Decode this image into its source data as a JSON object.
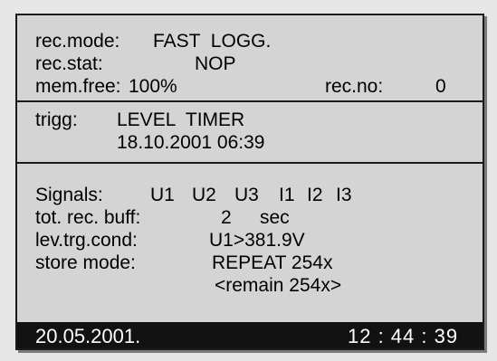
{
  "recording": {
    "mode_label": "rec.mode:",
    "mode_value": "FAST  LOGG.",
    "stat_label": "rec.stat:",
    "stat_value": "NOP",
    "mem_label": "mem.free:",
    "mem_value": "100%",
    "recno_label": "rec.no:",
    "recno_value": "0"
  },
  "trigger": {
    "label": "trigg:",
    "type": "LEVEL  TIMER",
    "datetime": "18.10.2001 06:39"
  },
  "signals": {
    "label": "Signals:",
    "values": [
      "U1",
      "U2",
      "U3",
      "I1",
      "I2",
      "I3"
    ],
    "buff_label": "tot. rec. buff:",
    "buff_value": "2",
    "buff_unit": "sec",
    "cond_label": "lev.trg.cond:",
    "cond_value": "U1>381.9V",
    "store_label": "store mode:",
    "store_value": "REPEAT 254x",
    "remain": "<remain 254x>"
  },
  "status": {
    "date": "20.05.2001.",
    "time": "12 : 44 : 39"
  }
}
